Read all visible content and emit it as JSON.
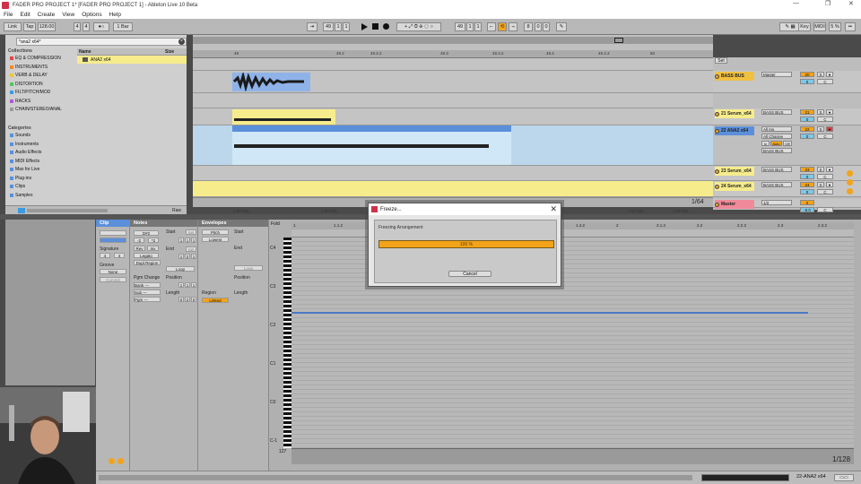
{
  "window": {
    "title": "FADER PRO PROJECT 1* [FADER PRO PROJECT 1] - Ableton Live 10 Beta"
  },
  "menu": [
    "File",
    "Edit",
    "Create",
    "View",
    "Options",
    "Help"
  ],
  "transport": {
    "link": "Link",
    "tap": "Tap",
    "tempo": "128.00",
    "sig_num": "4",
    "sig_den": "4",
    "metro": "1 Bar",
    "position": [
      "49",
      "1",
      "1"
    ],
    "loop_start": [
      "49",
      "1",
      "1"
    ],
    "loop_len": [
      "8",
      "0",
      "0"
    ],
    "key_label": "Key",
    "midi_label": "MIDI",
    "cpu": "5 %"
  },
  "browser": {
    "search_value": "*ana2 x64*",
    "collections_header": "Collections",
    "collections": [
      {
        "label": "EQ & COMPRESSION",
        "color": "#e0464a"
      },
      {
        "label": "INSTRUMENTS",
        "color": "#f08a2a"
      },
      {
        "label": "VERB & DELAY",
        "color": "#e9c83c"
      },
      {
        "label": "DISTORTION",
        "color": "#59c263"
      },
      {
        "label": "FILT/PITCH/MOD",
        "color": "#3a9be2"
      },
      {
        "label": "RACKS",
        "color": "#b05ad0"
      },
      {
        "label": "CHAIN/STEREO/ANAL",
        "color": "#9a9a9a"
      }
    ],
    "categories_header": "Categories",
    "categories": [
      "Sounds",
      "Instruments",
      "Audio Effects",
      "MIDI Effects",
      "Max for Live",
      "Plug-ins",
      "Clips",
      "Samples"
    ],
    "col_name": "Name",
    "col_size": "Size",
    "result": "ANA2 x64",
    "raw_label": "Raw"
  },
  "arrangement": {
    "ruler_marks": [
      "49",
      "49.2",
      "49.2.2",
      "49.3",
      "49.3.2",
      "49.4",
      "49.4.3",
      "50"
    ],
    "time_marks": [
      "1:30:000",
      "1:30:400",
      "1:31:000",
      "1:31:400",
      "1:32:000"
    ],
    "zoom_label": "1/64"
  },
  "mixer": {
    "set_label": "Set",
    "tracks": [
      {
        "name": "BASS BUS",
        "route": "Master",
        "num": "20",
        "color": "#f0c040",
        "s": "S"
      },
      {
        "name": "21 Serum_x64",
        "route": "BASS BUS",
        "num": "21",
        "color": "#f6ec8c",
        "s": "S"
      },
      {
        "name": "22 ANA2 x64",
        "route": "All Ins",
        "route2": "All Channe",
        "route3": "BASS BUS",
        "num": "22",
        "color": "#5b8fd9",
        "s": "S",
        "in": "In",
        "auto": "Auto",
        "off": "Off"
      },
      {
        "name": "23 Serum_x64",
        "route": "BASS BUS",
        "num": "23",
        "color": "#f6ec8c",
        "s": "S"
      },
      {
        "name": "24 Serum_x64",
        "route": "BASS BUS",
        "num": "24",
        "color": "#f6ec8c",
        "s": "S"
      },
      {
        "name": "Master",
        "route": "1/2",
        "num": "0",
        "vol": "-9.0",
        "color": "#f08a9a"
      }
    ]
  },
  "clip_view": {
    "clip_header": "Clip",
    "notes_header": "Notes",
    "env_header": "Envelopes",
    "signature_label": "Signature",
    "sig_num": "4",
    "sig_den": "4",
    "groove_label": "Groove",
    "groove_value": "None",
    "commit": "Commit",
    "key_value": "D#2",
    "transpose": [
      "-2",
      "*2"
    ],
    "rev": "Rev",
    "inv": "Inv",
    "legato": "Legato",
    "dupl": "Dupl.Region",
    "start_label": "Start",
    "end_label": "End",
    "set": "Set",
    "loop": "Loop",
    "start_vals": [
      "1",
      "1",
      "1"
    ],
    "end_vals": [
      "1",
      "2",
      "1"
    ],
    "pgm_label": "Pgm Change",
    "bank": "Bank ---",
    "sub": "Sub ---",
    "pgm": "Pgm ---",
    "position_label": "Position",
    "length_label": "Length",
    "pos_vals": [
      "1",
      "1",
      "1"
    ],
    "len_vals": [
      "0",
      "2",
      "0"
    ],
    "env_source": "Pitch",
    "env_range": "Lowest",
    "region_label": "Region",
    "linked": "Linked",
    "env_start": "Start",
    "env_end": "End",
    "env_loop": "Loop",
    "env_pos": "Position",
    "env_len": "Length"
  },
  "pianoroll": {
    "fold": "Fold",
    "bar_marks": [
      "1",
      "1.1.2",
      "1.2",
      "1.2.2",
      "1.3",
      "1.3.2",
      "1.4",
      "1.4.2",
      "2",
      "2.1.2",
      "2.2",
      "2.2.2",
      "2.3",
      "2.3.2"
    ],
    "octave_labels": [
      "C4",
      "C3",
      "C2",
      "C1",
      "C0",
      "C-1"
    ],
    "vel_label": "127",
    "zoom_label": "1/128"
  },
  "status": {
    "track": "22-ANA2 x64"
  },
  "dialog": {
    "title": "Freeze...",
    "message": "Freezing Arrangement",
    "progress_pct": 100,
    "progress_text": "100 %",
    "cancel": "Cancel"
  }
}
